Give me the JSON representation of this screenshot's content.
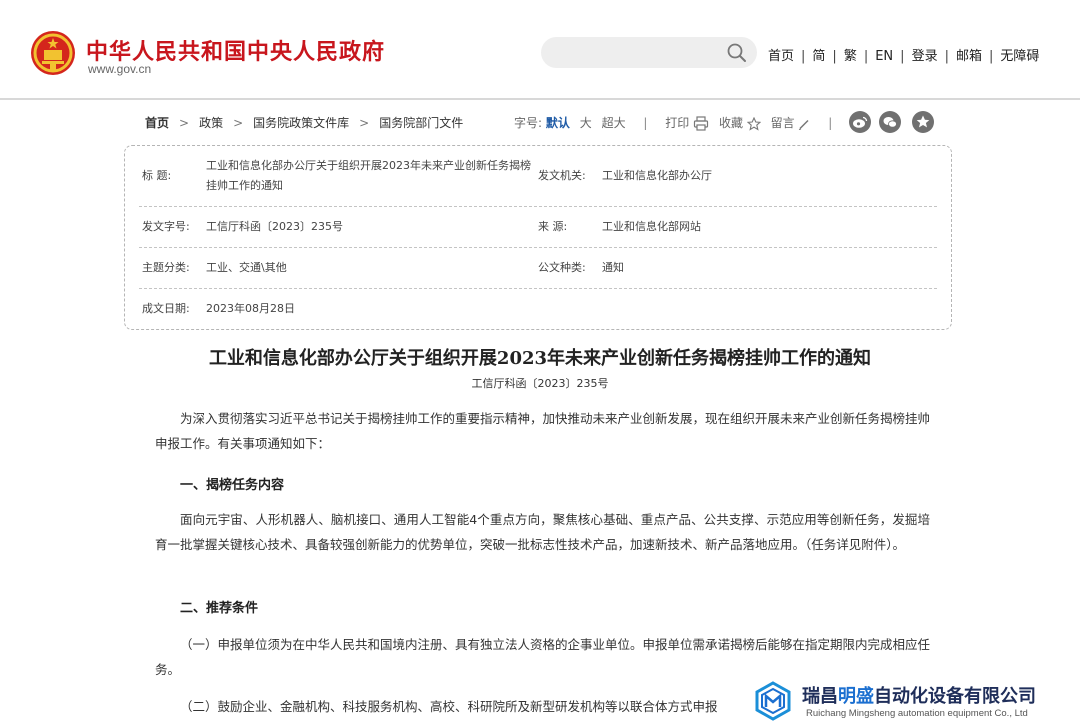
{
  "header": {
    "site_title": "中华人民共和国中央人民政府",
    "site_url": "www.gov.cn",
    "search": {
      "value": ""
    },
    "nav": [
      "首页",
      "简",
      "繁",
      "EN",
      "登录",
      "邮箱",
      "无障碍"
    ],
    "nav_separator": "|"
  },
  "breadcrumb": {
    "items": [
      "首页",
      "政策",
      "国务院政策文件库",
      "国务院部门文件"
    ],
    "separator": ">"
  },
  "tools": {
    "font_size_label": "字号:",
    "font_size_default": "默认",
    "font_size_large": "大",
    "font_size_xlarge": "超大",
    "print": "打印",
    "favorite": "收藏",
    "comment": "留言",
    "divider": "|"
  },
  "meta": {
    "title_label": "标    题:",
    "title_value": "工业和信息化部办公厅关于组织开展2023年未来产业创新任务揭榜挂帅工作的通知",
    "issuer_label": "发文机关:",
    "issuer_value": "工业和信息化部办公厅",
    "doc_no_label": "发文字号:",
    "doc_no_value": "工信厅科函〔2023〕235号",
    "source_label": "来    源:",
    "source_value": "工业和信息化部网站",
    "topic_label": "主题分类:",
    "topic_value": "工业、交通\\其他",
    "doc_type_label": "公文种类:",
    "doc_type_value": "通知",
    "date_label": "成文日期:",
    "date_value": "2023年08月28日"
  },
  "article": {
    "title": "工业和信息化部办公厅关于组织开展2023年未来产业创新任务揭榜挂帅工作的通知",
    "doc_no": "工信厅科函〔2023〕235号",
    "intro": "为深入贯彻落实习近平总书记关于揭榜挂帅工作的重要指示精神，加快推动未来产业创新发展，现在组织开展未来产业创新任务揭榜挂帅申报工作。有关事项通知如下：",
    "section1_heading": "一、揭榜任务内容",
    "section1_text": "面向元宇宙、人形机器人、脑机接口、通用人工智能4个重点方向，聚焦核心基础、重点产品、公共支撑、示范应用等创新任务，发掘培育一批掌握关键核心技术、具备较强创新能力的优势单位，突破一批标志性技术产品，加速新技术、新产品落地应用。（任务详见附件）。",
    "section2_heading": "二、推荐条件",
    "item1": "（一）申报单位须为在中华人民共和国境内注册、具有独立法人资格的企事业单位。申报单位需承诺揭榜后能够在指定期限内完成相应任务。",
    "item2": "（二）鼓励企业、金融机构、科技服务机构、高校、科研院所及新型研发机构等以联合体方式申报"
  },
  "watermark": {
    "name_part1": "瑞昌",
    "name_highlight": "明盛",
    "name_part2": "自动化设备有限公司",
    "english": "Ruichang Mingsheng automation equipment Co., Ltd"
  },
  "colors": {
    "brand_red": "#c8161d",
    "link_blue": "#1f5ba6",
    "watermark_blue": "#1b6fd0"
  }
}
